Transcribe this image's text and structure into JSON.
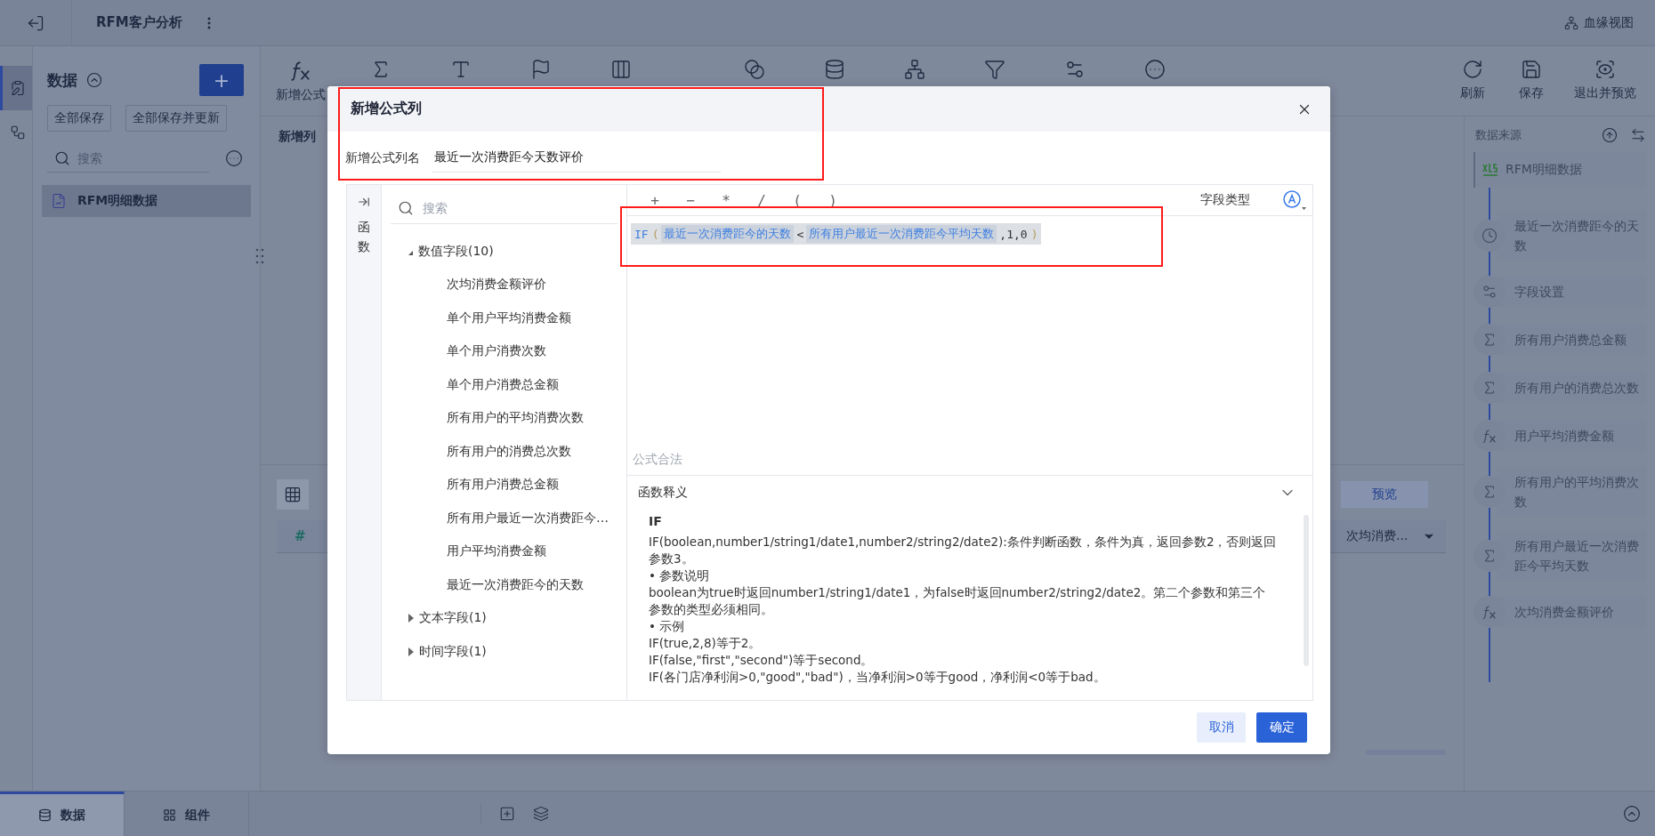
{
  "top_bar": {
    "title": "RFM客户分析",
    "lineage_button": "血缘视图"
  },
  "icon_rail": [
    {
      "kind": "data",
      "selected": true
    },
    {
      "kind": "flow",
      "selected": false
    }
  ],
  "data_panel": {
    "title": "数据",
    "add_button": "+",
    "buttons": [
      "全部保存",
      "全部保存并更新"
    ],
    "search": {
      "placeholder": "搜索"
    },
    "tables": [
      {
        "label": "RFM明细数据",
        "selected": true
      }
    ]
  },
  "toolbar": {
    "tools": [
      {
        "kind": "formula",
        "label": "新增公式"
      },
      {
        "kind": "sum"
      },
      {
        "kind": "text-format"
      },
      {
        "kind": "flag"
      },
      {
        "kind": "columns"
      },
      {
        "kind": "merge"
      },
      {
        "kind": "database"
      },
      {
        "kind": "hierarchy"
      },
      {
        "kind": "filter"
      },
      {
        "kind": "field-setting"
      },
      {
        "kind": "more"
      }
    ],
    "actions": [
      {
        "kind": "refresh",
        "label": "刷新"
      },
      {
        "kind": "save",
        "label": "保存"
      },
      {
        "kind": "exit-preview",
        "label": "退出并预览"
      }
    ]
  },
  "step_title": "新增列",
  "table_area": {
    "view_modes": [
      {
        "kind": "grid",
        "selected": true
      }
    ],
    "preview_button": "预览",
    "index_header": "#",
    "last_column": "次均消费..."
  },
  "bottom_bar": {
    "tabs": [
      {
        "kind": "data",
        "label": "数据",
        "selected": true
      },
      {
        "kind": "component",
        "label": "组件",
        "selected": false
      }
    ]
  },
  "lineage": {
    "title": "数据来源",
    "source": "RFM明细数据",
    "steps": [
      {
        "kind": "clock",
        "label": "最近一次消费距今的天数"
      },
      {
        "kind": "field-setting",
        "label": "字段设置"
      },
      {
        "kind": "sum",
        "label": "所有用户消费总金额"
      },
      {
        "kind": "sum",
        "label": "所有用户的消费总次数"
      },
      {
        "kind": "formula",
        "label": "用户平均消费金额"
      },
      {
        "kind": "sum",
        "label": "所有用户的平均消费次数"
      },
      {
        "kind": "sum",
        "label": "所有用户最近一次消费距今平均天数"
      },
      {
        "kind": "formula",
        "label": "次均消费金额评价"
      }
    ]
  },
  "dialog": {
    "title": "新增公式列",
    "title_highlighted": true,
    "name_label": "新增公式列名",
    "name_value": "最近一次消费距今天数评价",
    "side_tab": "函数",
    "search": {
      "placeholder": "搜索"
    },
    "field_groups": [
      {
        "label": "数值字段(10)",
        "expanded": true,
        "children": [
          {
            "label": "次均消费金额评价"
          },
          {
            "label": "单个用户平均消费金额"
          },
          {
            "label": "单个用户消费次数"
          },
          {
            "label": "单个用户消费总金额"
          },
          {
            "label": "所有用户的平均消费次数"
          },
          {
            "label": "所有用户的消费总次数"
          },
          {
            "label": "所有用户消费总金额"
          },
          {
            "label": "所有用户最近一次消费距今…"
          },
          {
            "label": "用户平均消费金额"
          },
          {
            "label": "最近一次消费距今的天数"
          }
        ]
      },
      {
        "label": "文本字段(1)",
        "expanded": false
      },
      {
        "label": "时间字段(1)",
        "expanded": false
      }
    ],
    "operators": [
      "+",
      "−",
      "*",
      "/",
      "(",
      ")"
    ],
    "field_type_label": "字段类型",
    "formula": {
      "highlighted": true,
      "tokens": [
        {
          "kind": "function",
          "text": "IF"
        },
        {
          "kind": "paren",
          "text": "("
        },
        {
          "kind": "field",
          "text": "最近一次消费距今的天数"
        },
        {
          "kind": "operator",
          "text": "<"
        },
        {
          "kind": "field",
          "text": "所有用户最近一次消费距今平均天数"
        },
        {
          "kind": "literal",
          "text": ",1,0"
        },
        {
          "kind": "paren",
          "text": ")"
        }
      ]
    },
    "status": "公式合法",
    "help": {
      "title": "函数释义",
      "expanded": true,
      "function_name": "IF",
      "lines": [
        "IF(boolean,number1/string1/date1,number2/string2/date2):条件判断函数，条件为真，返回参数2，否则返回参数3。",
        "•  参数说明",
        "boolean为true时返回number1/string1/date1，为false时返回number2/string2/date2。第二个参数和第三个参数的类型必须相同。",
        "•  示例",
        "IF(true,2,8)等于2。",
        "IF(false,\"first\",\"second\")等于second。",
        "IF(各门店净利润>0,\"good\",\"bad\")，当净利润>0等于good，净利润<0等于bad。"
      ]
    },
    "buttons": [
      {
        "kind": "cancel",
        "label": "取消"
      },
      {
        "kind": "confirm",
        "label": "确定"
      }
    ]
  }
}
